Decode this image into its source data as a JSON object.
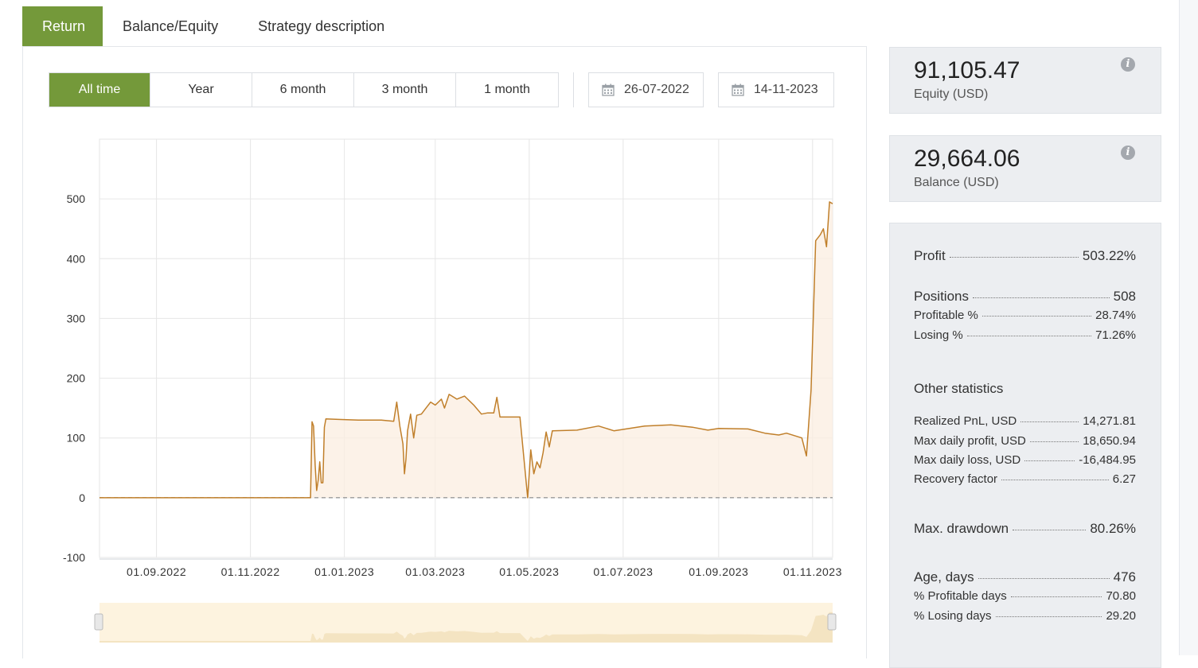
{
  "tabs": [
    "Return",
    "Balance/Equity",
    "Strategy description"
  ],
  "periods": [
    "All time",
    "Year",
    "6 month",
    "3 month",
    "1 month"
  ],
  "date_from": "26-07-2022",
  "date_to": "14-11-2023",
  "equity": {
    "value": "91,105.47",
    "caption": "Equity (USD)"
  },
  "balance": {
    "value": "29,664.06",
    "caption": "Balance (USD)"
  },
  "stats": {
    "profit": {
      "label": "Profit",
      "value": "503.22%"
    },
    "positions": {
      "label": "Positions",
      "value": "508"
    },
    "profitable_pct": {
      "label": "Profitable %",
      "value": "28.74%"
    },
    "losing_pct": {
      "label": "Losing %",
      "value": "71.26%"
    },
    "other_title": "Other statistics",
    "realized": {
      "label": "Realized PnL, USD",
      "value": "14,271.81"
    },
    "max_daily_profit": {
      "label": "Max daily profit, USD",
      "value": "18,650.94"
    },
    "max_daily_loss": {
      "label": "Max daily loss, USD",
      "value": "-16,484.95"
    },
    "recovery": {
      "label": "Recovery factor",
      "value": "6.27"
    },
    "max_drawdown": {
      "label": "Max. drawdown",
      "value": "80.26%"
    },
    "age": {
      "label": "Age, days",
      "value": "476"
    },
    "profitable_days": {
      "label": "% Profitable days",
      "value": "70.80"
    },
    "losing_days": {
      "label": "% Losing days",
      "value": "29.20"
    }
  },
  "colors": {
    "accent": "#74993a",
    "line": "#c07f2a",
    "fill": "#fbeee0"
  },
  "chart_data": {
    "type": "area",
    "title": "",
    "xlabel": "",
    "ylabel": "",
    "x_range": [
      "2022-07-26",
      "2023-11-14"
    ],
    "ylim": [
      -100,
      600
    ],
    "y_ticks": [
      -100,
      0,
      100,
      200,
      300,
      400,
      500
    ],
    "x_tick_labels": [
      "01.09.2022",
      "01.11.2022",
      "01.01.2023",
      "01.03.2023",
      "01.05.2023",
      "01.07.2023",
      "01.09.2023",
      "01.11.2023"
    ],
    "x_tick_dates": [
      "2022-09-01",
      "2022-11-01",
      "2023-01-01",
      "2023-03-01",
      "2023-05-01",
      "2023-07-01",
      "2023-09-01",
      "2023-11-01"
    ],
    "grid": true,
    "baseline": 0,
    "series": [
      {
        "points": [
          [
            "2022-07-26",
            0
          ],
          [
            "2022-12-10",
            0
          ],
          [
            "2022-12-11",
            127
          ],
          [
            "2022-12-12",
            120
          ],
          [
            "2022-12-13",
            55
          ],
          [
            "2022-12-14",
            12
          ],
          [
            "2022-12-15",
            30
          ],
          [
            "2022-12-16",
            60
          ],
          [
            "2022-12-17",
            25
          ],
          [
            "2022-12-18",
            25
          ],
          [
            "2022-12-19",
            118
          ],
          [
            "2022-12-20",
            132
          ],
          [
            "2022-12-28",
            131
          ],
          [
            "2023-01-10",
            130
          ],
          [
            "2023-01-25",
            130
          ],
          [
            "2023-02-02",
            128
          ],
          [
            "2023-02-04",
            160
          ],
          [
            "2023-02-06",
            120
          ],
          [
            "2023-02-08",
            90
          ],
          [
            "2023-02-09",
            40
          ],
          [
            "2023-02-10",
            65
          ],
          [
            "2023-02-11",
            112
          ],
          [
            "2023-02-13",
            140
          ],
          [
            "2023-02-15",
            100
          ],
          [
            "2023-02-17",
            138
          ],
          [
            "2023-02-20",
            140
          ],
          [
            "2023-02-23",
            150
          ],
          [
            "2023-02-26",
            160
          ],
          [
            "2023-03-01",
            155
          ],
          [
            "2023-03-05",
            165
          ],
          [
            "2023-03-07",
            150
          ],
          [
            "2023-03-10",
            173
          ],
          [
            "2023-03-15",
            165
          ],
          [
            "2023-03-20",
            170
          ],
          [
            "2023-03-26",
            155
          ],
          [
            "2023-03-31",
            140
          ],
          [
            "2023-04-04",
            142
          ],
          [
            "2023-04-08",
            142
          ],
          [
            "2023-04-10",
            168
          ],
          [
            "2023-04-12",
            135
          ],
          [
            "2023-04-25",
            135
          ],
          [
            "2023-04-30",
            0
          ],
          [
            "2023-05-02",
            80
          ],
          [
            "2023-05-04",
            40
          ],
          [
            "2023-05-06",
            60
          ],
          [
            "2023-05-08",
            50
          ],
          [
            "2023-05-10",
            75
          ],
          [
            "2023-05-12",
            110
          ],
          [
            "2023-05-14",
            85
          ],
          [
            "2023-05-16",
            112
          ],
          [
            "2023-06-01",
            113
          ],
          [
            "2023-06-15",
            120
          ],
          [
            "2023-06-25",
            112
          ],
          [
            "2023-07-15",
            120
          ],
          [
            "2023-08-01",
            122
          ],
          [
            "2023-08-15",
            118
          ],
          [
            "2023-08-25",
            113
          ],
          [
            "2023-09-01",
            116
          ],
          [
            "2023-09-20",
            115
          ],
          [
            "2023-10-01",
            108
          ],
          [
            "2023-10-10",
            105
          ],
          [
            "2023-10-15",
            108
          ],
          [
            "2023-10-25",
            100
          ],
          [
            "2023-10-28",
            70
          ],
          [
            "2023-10-31",
            180
          ],
          [
            "2023-11-03",
            430
          ],
          [
            "2023-11-06",
            440
          ],
          [
            "2023-11-08",
            450
          ],
          [
            "2023-11-10",
            420
          ],
          [
            "2023-11-12",
            495
          ],
          [
            "2023-11-14",
            492
          ]
        ]
      }
    ]
  }
}
